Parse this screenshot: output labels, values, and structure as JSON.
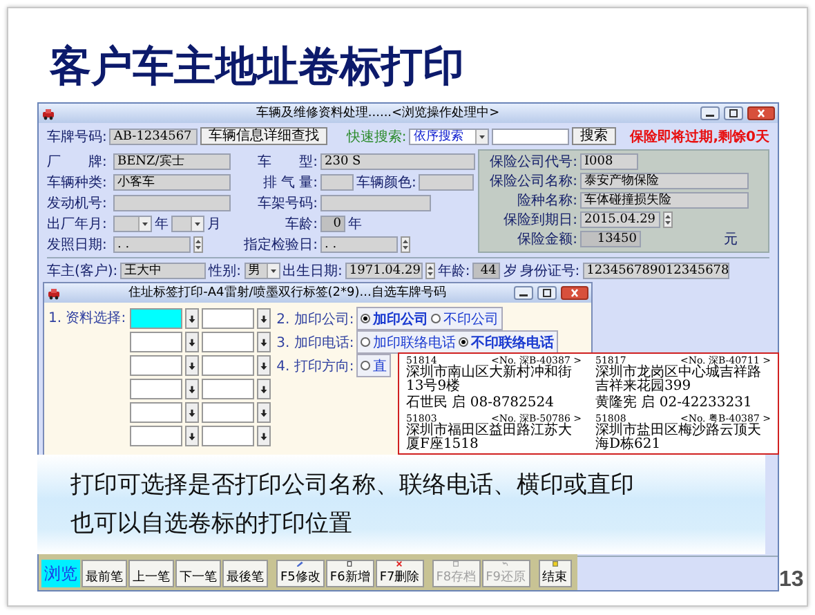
{
  "slide": {
    "title": "客户车主地址卷标打印",
    "caption": [
      "打印可选择是否打印公司名称、联络电话、横印或直印",
      "也可以自选卷标的打印位置"
    ],
    "page_number": "13"
  },
  "main_window": {
    "title": "车辆及维修资料处理......<浏览操作处理中>",
    "top_row": {
      "plate_label": "车牌号码:",
      "plate_value": "AB-1234567",
      "detail_button": "车辆信息详细查找",
      "quick_search_label": "快速搜索:",
      "search_mode": "依序搜索",
      "search_button": "搜索",
      "warning": "保险即将过期,剩馀0天"
    },
    "vehicle_rows": [
      {
        "left": [
          {
            "kind": "label",
            "text": "厂　　牌:"
          },
          {
            "kind": "text",
            "value": "BENZ/宾士"
          }
        ],
        "right": [
          {
            "kind": "label",
            "text": "车　　型:"
          },
          {
            "kind": "text",
            "value": "230 S"
          }
        ]
      },
      {
        "left": [
          {
            "kind": "label",
            "text": "车辆种类:"
          },
          {
            "kind": "text",
            "value": "小客车"
          }
        ],
        "right": [
          {
            "kind": "label",
            "text": "排 气 量:"
          },
          {
            "kind": "text"
          },
          {
            "kind": "label",
            "text": "车辆颜色:"
          },
          {
            "kind": "text"
          }
        ]
      },
      {
        "left": [
          {
            "kind": "label",
            "text": "发动机号:"
          },
          {
            "kind": "text"
          }
        ],
        "right": [
          {
            "kind": "label",
            "text": "车架号码:"
          },
          {
            "kind": "text"
          }
        ]
      },
      {
        "left": [
          {
            "kind": "label",
            "text": "出厂年月:"
          },
          {
            "kind": "combo"
          },
          {
            "kind": "unit",
            "text": "年"
          },
          {
            "kind": "combo"
          },
          {
            "kind": "unit",
            "text": "月"
          }
        ],
        "right": [
          {
            "kind": "label",
            "text": "车龄:"
          },
          {
            "kind": "readonly",
            "value": "0"
          },
          {
            "kind": "unit",
            "text": "年"
          }
        ]
      },
      {
        "left": [
          {
            "kind": "label",
            "text": "发照日期:"
          },
          {
            "kind": "spin",
            "value": ". ."
          }
        ],
        "right": [
          {
            "kind": "label",
            "text": "指定检验日:"
          },
          {
            "kind": "spin",
            "value": ". ."
          }
        ]
      }
    ],
    "insurance_rows": [
      {
        "label": "保险公司代号:",
        "value": "I008",
        "kind": "text"
      },
      {
        "label": "保险公司名称:",
        "value": "泰安产物保险",
        "kind": "text"
      },
      {
        "label": "险种名称:",
        "value": "车体碰撞损失险",
        "kind": "text"
      },
      {
        "label": "保险到期日:",
        "value": "2015.04.29",
        "kind": "spin"
      },
      {
        "label": "保险金额:",
        "value": "13450",
        "kind": "amount",
        "unit": "元"
      }
    ],
    "owner_row": [
      {
        "kind": "label",
        "text": "车主(客户):"
      },
      {
        "kind": "text",
        "value": "王大中"
      },
      {
        "kind": "label",
        "text": "性别:"
      },
      {
        "kind": "combo",
        "value": "男"
      },
      {
        "kind": "label",
        "text": "出生日期:"
      },
      {
        "kind": "spin",
        "value": "1971.04.29"
      },
      {
        "kind": "label",
        "text": "年龄:"
      },
      {
        "kind": "readonly",
        "value": "44"
      },
      {
        "kind": "unit",
        "text": "岁"
      },
      {
        "kind": "label",
        "text": "身份证号:"
      },
      {
        "kind": "text",
        "value": "123456789012345678"
      }
    ],
    "mode_indicator": "浏览",
    "toolbar": [
      {
        "label": "最前笔",
        "kind": "nav",
        "disabled": false
      },
      {
        "label": "上一笔",
        "kind": "nav",
        "disabled": false
      },
      {
        "label": "下一笔",
        "kind": "nav",
        "disabled": false
      },
      {
        "label": "最後笔",
        "kind": "nav",
        "disabled": false
      },
      {
        "label": "F5修改",
        "kind": "edit",
        "disabled": false
      },
      {
        "label": "F6新增",
        "kind": "add",
        "disabled": false
      },
      {
        "label": "F7删除",
        "kind": "delete",
        "disabled": false
      },
      {
        "label": "F8存档",
        "kind": "save",
        "disabled": true
      },
      {
        "label": "F9还原",
        "kind": "restore",
        "disabled": true
      },
      {
        "label": "结束",
        "kind": "exit",
        "disabled": false
      }
    ]
  },
  "print_dialog": {
    "title": "住址标签打印-A4雷射/喷墨双行标签(2*9)...自选车牌号码",
    "data_select_label": "1. 资料选择:",
    "data_slots": [
      {
        "focused": true
      },
      {
        "focused": false
      },
      {
        "focused": false
      },
      {
        "focused": false
      },
      {
        "focused": false
      },
      {
        "focused": false
      },
      {
        "focused": false
      },
      {
        "focused": false
      },
      {
        "focused": false
      },
      {
        "focused": false
      },
      {
        "focused": false
      },
      {
        "focused": false
      }
    ],
    "options": [
      {
        "label": "2. 加印公司:",
        "choices": [
          {
            "text": "加印公司",
            "selected": true
          },
          {
            "text": "不印公司",
            "selected": false
          }
        ]
      },
      {
        "label": "3. 加印电话:",
        "choices": [
          {
            "text": "加印联络电话",
            "selected": false
          },
          {
            "text": "不印联络电话",
            "selected": true
          }
        ]
      },
      {
        "label": "4. 打印方向:",
        "choices": [
          {
            "text": "直",
            "selected": false
          }
        ]
      }
    ]
  },
  "label_preview": [
    {
      "zip": "51814",
      "car_no": "<No. 深B-40387 >",
      "address": "深圳市南山区大新村冲和街13号9楼",
      "recipient": "石世民 启 08-8782524"
    },
    {
      "zip": "51817",
      "car_no": "<No. 深B-40711 >",
      "address": "深圳市龙岗区中心城吉祥路吉祥来花园399",
      "recipient": "黄隆宪 启 02-42233231"
    },
    {
      "zip": "51803",
      "car_no": "<No. 深B-50786 >",
      "address": "深圳市福田区益田路江苏大厦F座1518"
    },
    {
      "zip": "51808",
      "car_no": "<No. 粤B-40387 >",
      "address": "深圳市盐田区梅沙路云顶天海D栋621"
    }
  ]
}
